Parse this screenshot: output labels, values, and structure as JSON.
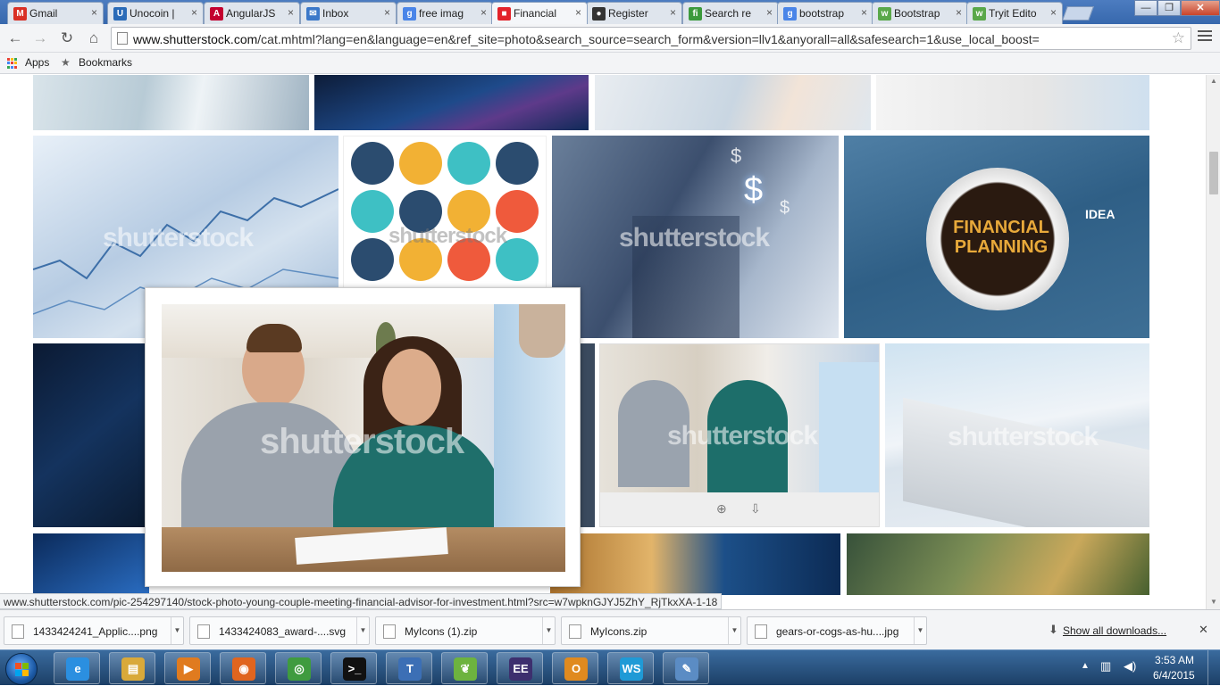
{
  "tabs": [
    {
      "label": "Gmail",
      "icon": "gmail-icon",
      "fav": "M",
      "color": "#d93025"
    },
    {
      "label": "Unocoin |",
      "icon": "unocoin-icon",
      "fav": "U",
      "color": "#2a6bb8"
    },
    {
      "label": "AngularJS",
      "icon": "angular-icon",
      "fav": "A",
      "color": "#c3002f"
    },
    {
      "label": "Inbox",
      "icon": "inbox-icon",
      "fav": "✉",
      "color": "#3b78c9"
    },
    {
      "label": "free imag",
      "icon": "google-icon",
      "fav": "g",
      "color": "#4a85e8"
    },
    {
      "label": "Financial",
      "icon": "shutterstock-icon",
      "fav": "■",
      "color": "#e3232a"
    },
    {
      "label": "Register",
      "icon": "github-icon",
      "fav": "●",
      "color": "#333333"
    },
    {
      "label": "Search re",
      "icon": "fiverr-icon",
      "fav": "fi",
      "color": "#3c9a3c"
    },
    {
      "label": "bootstrap",
      "icon": "google-icon",
      "fav": "g",
      "color": "#4a85e8"
    },
    {
      "label": "Bootstrap",
      "icon": "tryit-icon",
      "fav": "w",
      "color": "#5aa84a"
    },
    {
      "label": "Tryit Edito",
      "icon": "tryit-icon",
      "fav": "w",
      "color": "#5aa84a"
    }
  ],
  "window_controls": {
    "minimize": "—",
    "restore": "❐",
    "close": "✕"
  },
  "toolbar": {
    "back": "←",
    "forward": "→",
    "reload": "↻",
    "home": "⌂",
    "url_host": "www.shutterstock.com",
    "url_path": "/cat.mhtml?lang=en&language=en&ref_site=photo&search_source=search_form&version=llv1&anyorall=all&safesearch=1&use_local_boost=",
    "star": "☆"
  },
  "bookmarks": {
    "apps_label": "Apps",
    "bookmarks_label": "Bookmarks"
  },
  "gallery": {
    "watermark": "shutterstock",
    "financial_planning_text": "FINANCIAL PLANNING",
    "idea_text": "IDEA",
    "popup_alt": "stock-photo-young-couple-meeting-financial-advisor-for-investment"
  },
  "status_url": "www.shutterstock.com/pic-254297140/stock-photo-young-couple-meeting-financial-advisor-for-investment.html?src=w7wpknGJYJ5ZhY_RjTkxXA-1-18",
  "downloads": [
    {
      "name": "1433424241_Applic....png",
      "icon": "png-file-icon"
    },
    {
      "name": "1433424083_award-....svg",
      "icon": "svg-file-icon"
    },
    {
      "name": "MyIcons (1).zip",
      "icon": "zip-file-icon"
    },
    {
      "name": "MyIcons.zip",
      "icon": "zip-file-icon"
    },
    {
      "name": "gears-or-cogs-as-hu....jpg",
      "icon": "jpg-file-icon"
    }
  ],
  "show_all_downloads": "Show all downloads...",
  "taskbar": {
    "apps": [
      {
        "name": "internet-explorer-icon",
        "glyph": "e",
        "color": "#2b8fe0"
      },
      {
        "name": "file-explorer-icon",
        "glyph": "▤",
        "color": "#d9a93a"
      },
      {
        "name": "media-player-icon",
        "glyph": "▶",
        "color": "#e07b1f"
      },
      {
        "name": "firefox-icon",
        "glyph": "◉",
        "color": "#e0651f"
      },
      {
        "name": "chrome-icon",
        "glyph": "◎",
        "color": "#3f9b3f"
      },
      {
        "name": "command-prompt-icon",
        "glyph": ">_",
        "color": "#111111"
      },
      {
        "name": "text-editor-icon",
        "glyph": "T",
        "color": "#3c6fb5"
      },
      {
        "name": "spring-tool-icon",
        "glyph": "❦",
        "color": "#6db33f"
      },
      {
        "name": "eclipse-java-ee-icon",
        "glyph": "EE",
        "color": "#3d2f6e"
      },
      {
        "name": "outlook-icon",
        "glyph": "O",
        "color": "#e08a1f"
      },
      {
        "name": "webstorm-icon",
        "glyph": "WS",
        "color": "#1f9ad6"
      },
      {
        "name": "paint-icon",
        "glyph": "✎",
        "color": "#5b8cc4"
      }
    ],
    "time": "3:53 AM",
    "date": "6/4/2015"
  }
}
